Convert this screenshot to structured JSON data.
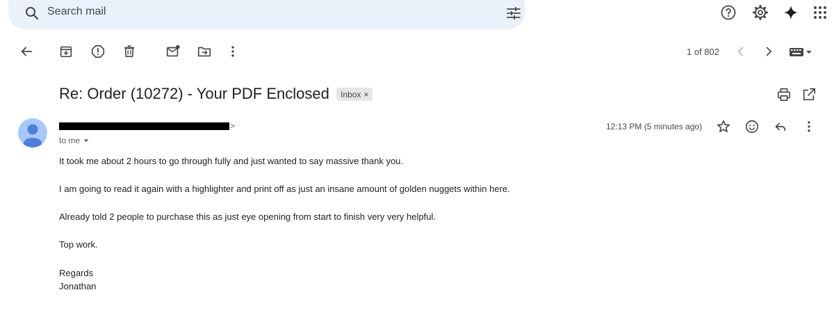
{
  "search": {
    "placeholder": "Search mail"
  },
  "toolbar": {
    "pager": "1 of 802"
  },
  "email": {
    "subject": "Re: Order (10272) - Your PDF Enclosed",
    "label": "Inbox",
    "label_close": "×",
    "sender_tail": ">",
    "recipient": "to me",
    "time": "12:13 PM (5 minutes ago)",
    "body": [
      "It took me about 2 hours to go through fully and just wanted to say massive thank you.",
      "I am going to read it again with a highlighter and print off as just an insane amount of golden nuggets within here.",
      "Already told 2 people to purchase this as just eye opening from start to finish very very helpful.",
      "Top work.",
      "Regards",
      "Jonathan"
    ]
  },
  "colors": {
    "search_bg": "#eaf1fb",
    "avatar_bg": "#a8c7fa",
    "avatar_fg": "#4f7fd9"
  },
  "icons": [
    "search-icon",
    "filter-icon",
    "help-icon",
    "settings-icon",
    "sparkle-icon",
    "apps-icon",
    "back-arrow-icon",
    "archive-icon",
    "report-spam-icon",
    "delete-icon",
    "mark-unread-icon",
    "move-to-icon",
    "more-icon",
    "chevron-left-icon",
    "chevron-right-icon",
    "keyboard-icon",
    "print-icon",
    "open-new-window-icon",
    "star-icon",
    "emoji-icon",
    "reply-icon"
  ]
}
